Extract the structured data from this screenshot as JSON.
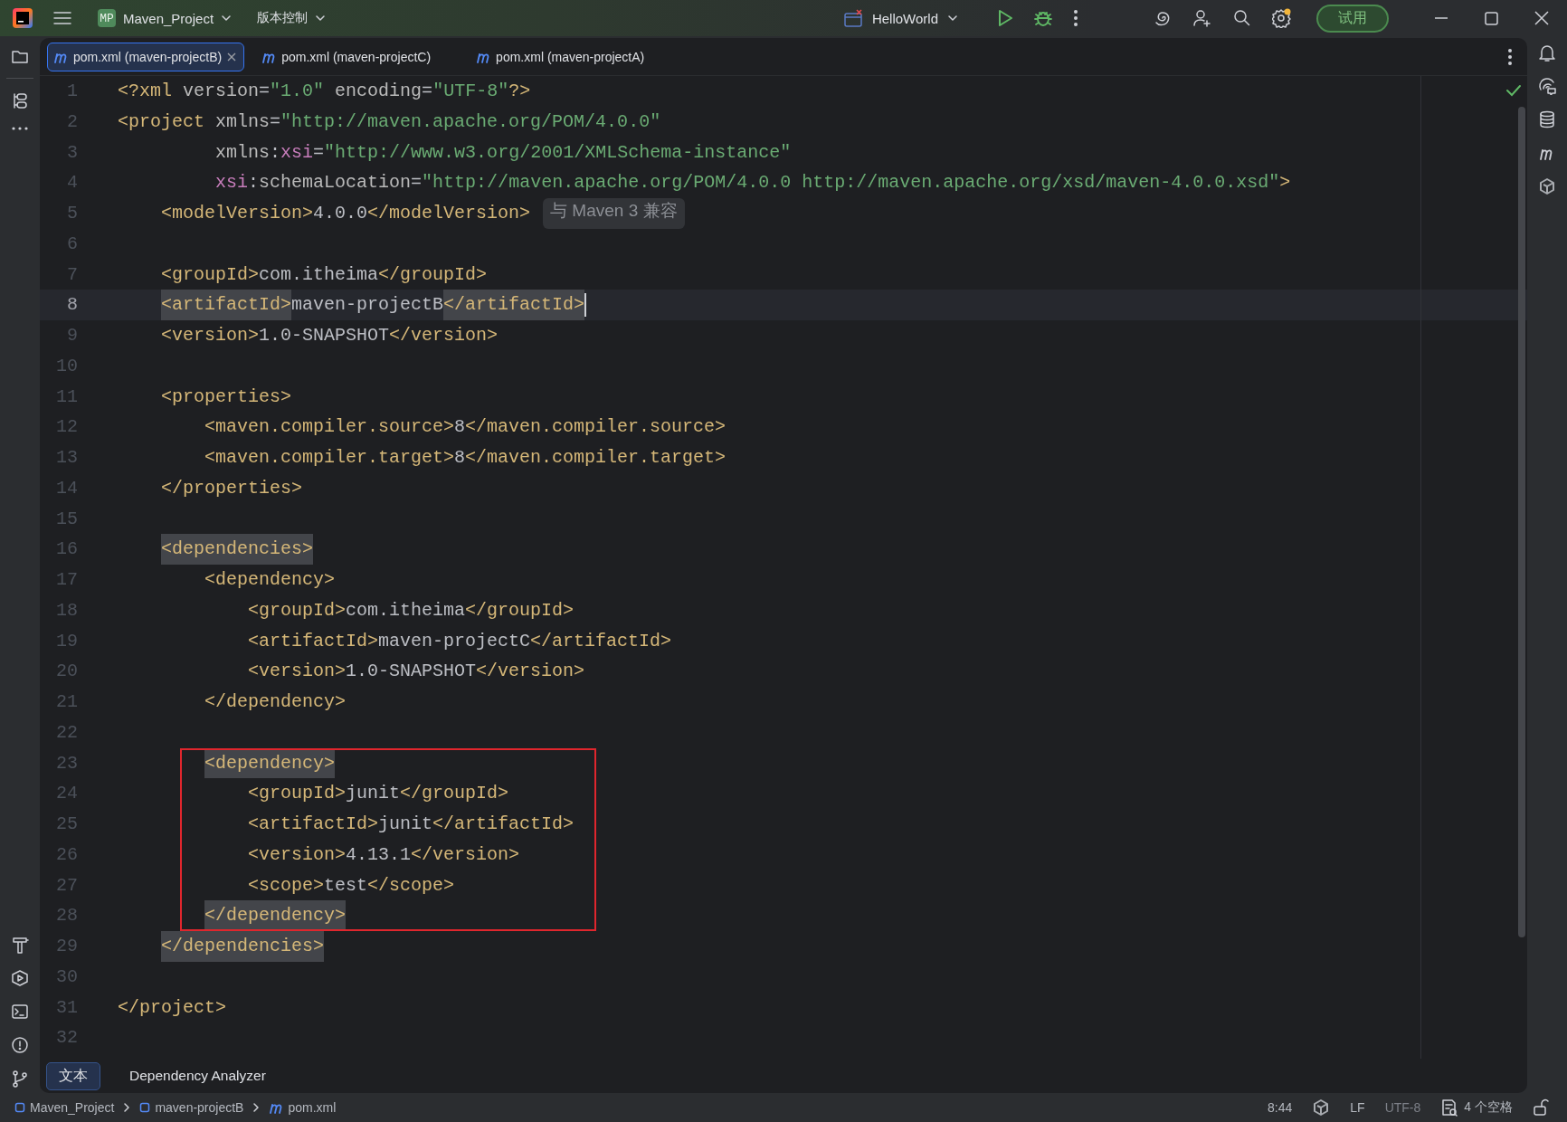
{
  "title_bar": {
    "project_badge": "MP",
    "project": "Maven_Project",
    "vcs": "版本控制",
    "run_config": "HelloWorld",
    "trial_button": "试用",
    "settings_notification": true
  },
  "tabs": [
    {
      "label": "pom.xml (maven-projectB)",
      "selected": true
    },
    {
      "label": "pom.xml (maven-projectC)",
      "selected": false
    },
    {
      "label": "pom.xml (maven-projectA)",
      "selected": false
    }
  ],
  "editor": {
    "lines": [
      {
        "number": "1",
        "current": false,
        "boxed": false,
        "tokens": [
          {
            "kind": "tag",
            "text": "<?xml"
          },
          {
            "kind": "attr",
            "text": " version"
          },
          {
            "kind": "text",
            "text": "="
          },
          {
            "kind": "value",
            "text": "\"1.0\""
          },
          {
            "kind": "attr",
            "text": " encoding"
          },
          {
            "kind": "text",
            "text": "="
          },
          {
            "kind": "value",
            "text": "\"UTF-8\""
          },
          {
            "kind": "tag",
            "text": "?>"
          }
        ]
      },
      {
        "number": "2",
        "current": false,
        "boxed": false,
        "tokens": [
          {
            "kind": "tag",
            "text": "<project"
          },
          {
            "kind": "attr",
            "text": " xmlns"
          },
          {
            "kind": "text",
            "text": "="
          },
          {
            "kind": "value",
            "text": "\"http://maven.apache.org/POM/4.0.0\""
          }
        ]
      },
      {
        "number": "3",
        "current": false,
        "boxed": false,
        "tokens": [
          {
            "kind": "attr",
            "text": "         xmlns"
          },
          {
            "kind": "text",
            "text": ":"
          },
          {
            "kind": "ns",
            "text": "xsi"
          },
          {
            "kind": "text",
            "text": "="
          },
          {
            "kind": "value",
            "text": "\"http://www.w3.org/2001/XMLSchema-instance\""
          }
        ]
      },
      {
        "number": "4",
        "current": false,
        "boxed": false,
        "tokens": [
          {
            "kind": "ns",
            "text": "         xsi"
          },
          {
            "kind": "text",
            "text": ":"
          },
          {
            "kind": "attr",
            "text": "schemaLocation"
          },
          {
            "kind": "text",
            "text": "="
          },
          {
            "kind": "value",
            "text": "\"http://maven.apache.org/POM/4.0.0 http://maven.apache.org/xsd/maven-4.0.0.xsd\""
          },
          {
            "kind": "tag",
            "text": ">"
          }
        ]
      },
      {
        "number": "5",
        "current": false,
        "boxed": false,
        "hint": "与 Maven 3 兼容",
        "tokens": [
          {
            "kind": "tag",
            "text": "    <modelVersion>"
          },
          {
            "kind": "text",
            "text": "4.0.0"
          },
          {
            "kind": "tag",
            "text": "</modelVersion>"
          }
        ]
      },
      {
        "number": "6",
        "current": false,
        "boxed": false
      },
      {
        "number": "7",
        "current": false,
        "boxed": false,
        "tokens": [
          {
            "kind": "tag",
            "text": "    <groupId>"
          },
          {
            "kind": "text",
            "text": "com.itheima"
          },
          {
            "kind": "tag",
            "text": "</groupId>"
          }
        ]
      },
      {
        "number": "8",
        "current": true,
        "boxed": false,
        "tokens": [
          {
            "kind": "tag_matched",
            "text": "    <artifactId>"
          },
          {
            "kind": "text",
            "text": "maven-projectB"
          },
          {
            "kind": "tag_matched",
            "text": "</artifactId>"
          }
        ]
      },
      {
        "number": "9",
        "current": false,
        "boxed": false,
        "tokens": [
          {
            "kind": "tag",
            "text": "    <version>"
          },
          {
            "kind": "text",
            "text": "1.0-SNAPSHOT"
          },
          {
            "kind": "tag",
            "text": "</version>"
          }
        ]
      },
      {
        "number": "10",
        "current": false,
        "boxed": false
      },
      {
        "number": "11",
        "current": false,
        "boxed": false,
        "tokens": [
          {
            "kind": "tag",
            "text": "    <properties>"
          }
        ]
      },
      {
        "number": "12",
        "current": false,
        "boxed": false,
        "tokens": [
          {
            "kind": "tag",
            "text": "        <maven.compiler.source>"
          },
          {
            "kind": "text",
            "text": "8"
          },
          {
            "kind": "tag",
            "text": "</maven.compiler.source>"
          }
        ]
      },
      {
        "number": "13",
        "current": false,
        "boxed": false,
        "tokens": [
          {
            "kind": "tag",
            "text": "        <maven.compiler.target>"
          },
          {
            "kind": "text",
            "text": "8"
          },
          {
            "kind": "tag",
            "text": "</maven.compiler.target>"
          }
        ]
      },
      {
        "number": "14",
        "current": false,
        "boxed": false,
        "tokens": [
          {
            "kind": "tag",
            "text": "    </properties>"
          }
        ]
      },
      {
        "number": "15",
        "current": false,
        "boxed": false
      },
      {
        "number": "16",
        "current": false,
        "boxed": false,
        "tokens": [
          {
            "kind": "tag_matched",
            "text": "    <dependencies>"
          }
        ]
      },
      {
        "number": "17",
        "current": false,
        "boxed": false,
        "tokens": [
          {
            "kind": "tag",
            "text": "        <dependency>"
          }
        ]
      },
      {
        "number": "18",
        "current": false,
        "boxed": false,
        "tokens": [
          {
            "kind": "tag",
            "text": "            <groupId>"
          },
          {
            "kind": "text",
            "text": "com.itheima"
          },
          {
            "kind": "tag",
            "text": "</groupId>"
          }
        ]
      },
      {
        "number": "19",
        "current": false,
        "boxed": false,
        "tokens": [
          {
            "kind": "tag",
            "text": "            <artifactId>"
          },
          {
            "kind": "text",
            "text": "maven-projectC"
          },
          {
            "kind": "tag",
            "text": "</artifactId>"
          }
        ]
      },
      {
        "number": "20",
        "current": false,
        "boxed": false,
        "tokens": [
          {
            "kind": "tag",
            "text": "            <version>"
          },
          {
            "kind": "text",
            "text": "1.0-SNAPSHOT"
          },
          {
            "kind": "tag",
            "text": "</version>"
          }
        ]
      },
      {
        "number": "21",
        "current": false,
        "boxed": false,
        "tokens": [
          {
            "kind": "tag",
            "text": "        </dependency>"
          }
        ]
      },
      {
        "number": "22",
        "current": false,
        "boxed": false
      },
      {
        "number": "23",
        "current": false,
        "boxed": true,
        "tokens": [
          {
            "kind": "tag_matched",
            "text": "        <dependency>"
          }
        ]
      },
      {
        "number": "24",
        "current": false,
        "boxed": true,
        "tokens": [
          {
            "kind": "tag",
            "text": "            <groupId>"
          },
          {
            "kind": "text",
            "text": "junit"
          },
          {
            "kind": "tag",
            "text": "</groupId>"
          }
        ]
      },
      {
        "number": "25",
        "current": false,
        "boxed": true,
        "tokens": [
          {
            "kind": "tag",
            "text": "            <artifactId>"
          },
          {
            "kind": "text",
            "text": "junit"
          },
          {
            "kind": "tag",
            "text": "</artifactId>"
          }
        ]
      },
      {
        "number": "26",
        "current": false,
        "boxed": true,
        "tokens": [
          {
            "kind": "tag",
            "text": "            <version>"
          },
          {
            "kind": "text",
            "text": "4.13.1"
          },
          {
            "kind": "tag",
            "text": "</version>"
          }
        ]
      },
      {
        "number": "27",
        "current": false,
        "boxed": true,
        "tokens": [
          {
            "kind": "tag",
            "text": "            <scope>"
          },
          {
            "kind": "text",
            "text": "test"
          },
          {
            "kind": "tag",
            "text": "</scope>"
          }
        ]
      },
      {
        "number": "28",
        "current": false,
        "boxed": true,
        "tokens": [
          {
            "kind": "tag_matched",
            "text": "        </dependency>"
          }
        ]
      },
      {
        "number": "29",
        "current": false,
        "boxed": false,
        "tokens": [
          {
            "kind": "tag_matched",
            "text": "    </dependencies>"
          }
        ]
      },
      {
        "number": "30",
        "current": false,
        "boxed": false
      },
      {
        "number": "31",
        "current": false,
        "boxed": false,
        "tokens": [
          {
            "kind": "tag",
            "text": "</project>"
          }
        ]
      },
      {
        "number": "32",
        "current": false,
        "boxed": false
      }
    ]
  },
  "bottom_tabs": [
    {
      "label": "文本",
      "selected": true
    },
    {
      "label": "Dependency Analyzer",
      "selected": false
    }
  ],
  "breadcrumbs": [
    {
      "label": "Maven_Project",
      "kind": "module"
    },
    {
      "label": "maven-projectB",
      "kind": "module"
    },
    {
      "label": "pom.xml",
      "kind": "maven"
    }
  ],
  "status_bar": {
    "position": "8:44",
    "line_separator": "LF",
    "encoding": "UTF-8",
    "indent": "4 个空格"
  }
}
